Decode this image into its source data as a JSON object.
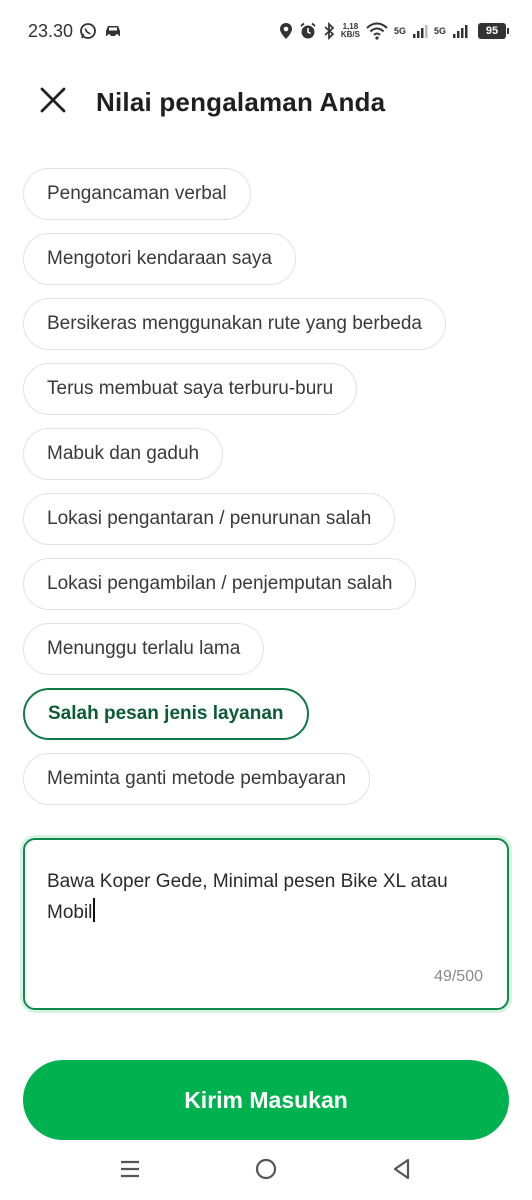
{
  "status_bar": {
    "time": "23.30",
    "speed_value": "1,18",
    "speed_unit": "KB/S",
    "network_1": "5G",
    "network_2": "5G",
    "battery": "95"
  },
  "header": {
    "title": "Nilai pengalaman Anda"
  },
  "chips": [
    {
      "label": "Pengancaman verbal",
      "selected": false
    },
    {
      "label": "Mengotori kendaraan saya",
      "selected": false
    },
    {
      "label": "Bersikeras menggunakan rute yang berbeda",
      "selected": false
    },
    {
      "label": "Terus membuat saya terburu-buru",
      "selected": false
    },
    {
      "label": "Mabuk dan gaduh",
      "selected": false
    },
    {
      "label": "Lokasi pengantaran / penurunan salah",
      "selected": false
    },
    {
      "label": "Lokasi pengambilan / penjemputan salah",
      "selected": false
    },
    {
      "label": "Menunggu terlalu lama",
      "selected": false
    },
    {
      "label": "Salah pesan jenis layanan",
      "selected": true
    },
    {
      "label": "Meminta ganti metode pembayaran",
      "selected": false
    }
  ],
  "feedback": {
    "value": "Bawa Koper Gede, Minimal pesen Bike XL atau Mobil",
    "char_count": "49/500"
  },
  "submit": {
    "label": "Kirim Masukan"
  },
  "colors": {
    "brand_green": "#00b14f",
    "selected_border": "#0f7a45",
    "selected_text": "#0b5c34"
  }
}
